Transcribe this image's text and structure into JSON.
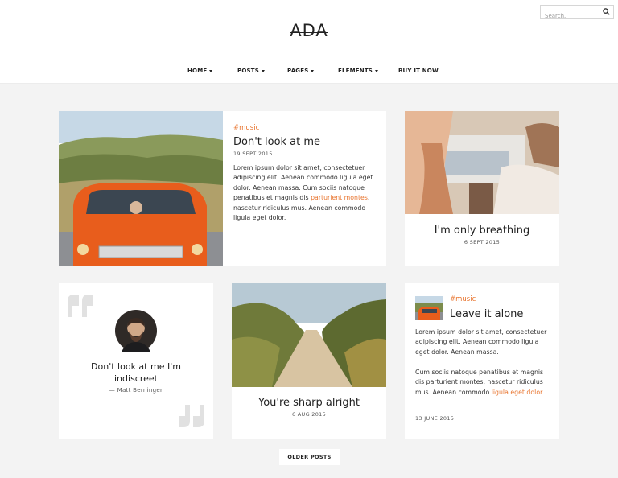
{
  "site": {
    "logo": "ADA"
  },
  "search": {
    "placeholder": "Search.."
  },
  "nav": [
    {
      "label": "HOME",
      "has_dropdown": true,
      "active": true
    },
    {
      "label": "POSTS",
      "has_dropdown": true
    },
    {
      "label": "PAGES",
      "has_dropdown": true
    },
    {
      "label": "ELEMENTS",
      "has_dropdown": true
    },
    {
      "label": "BUY IT NOW",
      "has_dropdown": false
    }
  ],
  "posts": {
    "featured": {
      "tag": "#music",
      "title": "Don't look at me",
      "date": "19 SEPT 2015",
      "excerpt_before": "Lorem ipsum dolor sit amet, consectetuer adipiscing elit. Aenean commodo ligula eget dolor. Aenean massa. Cum sociis natoque penatibus et magnis dis ",
      "excerpt_link": "parturient montes",
      "excerpt_after": ", nascetur ridiculus mus. Aenean commodo ligula eget dolor."
    },
    "breathing": {
      "title": "I'm only breathing",
      "date": "6 SEPT 2015"
    },
    "quote": {
      "text": "Don't look at me I'm indiscreet",
      "author": "— Matt Berninger"
    },
    "sharp": {
      "title": "You're sharp alright",
      "date": "6 AUG 2015"
    },
    "leave": {
      "tag": "#music",
      "title": "Leave it alone",
      "para1": "Lorem ipsum dolor sit amet, consectetuer adipiscing elit. Aenean commodo ligula eget dolor. Aenean massa.",
      "para2_before": "Cum sociis natoque penatibus et magnis dis parturient montes, nascetur ridiculus mus. Aenean commodo ",
      "para2_link": "ligula eget dolor",
      "para2_after": ".",
      "date": "13 JUNE 2015"
    }
  },
  "pagination": {
    "older_label": "OLDER POSTS"
  },
  "colors": {
    "accent": "#e8742e",
    "background": "#f3f3f3",
    "card": "#ffffff"
  }
}
